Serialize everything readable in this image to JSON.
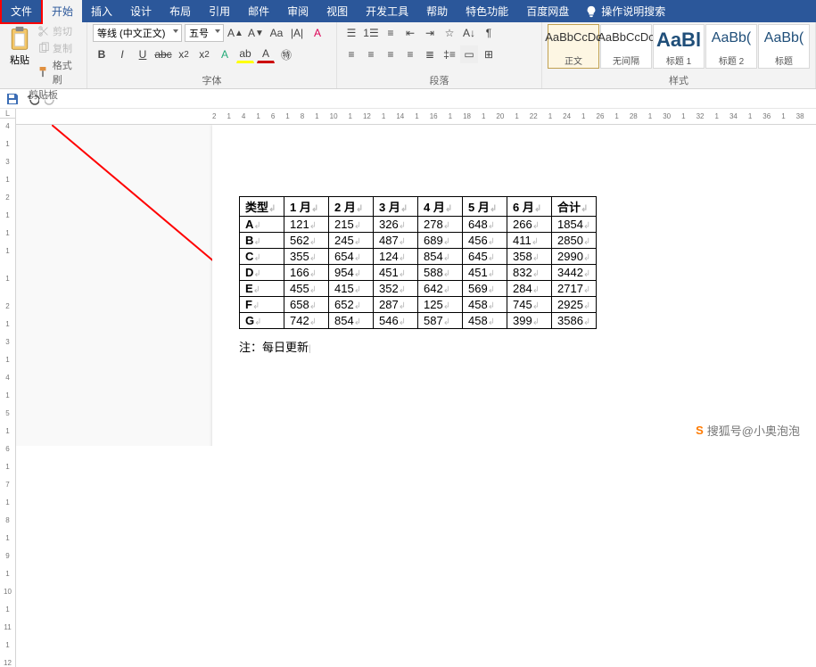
{
  "menu": {
    "file": "文件",
    "home": "开始",
    "insert": "插入",
    "design": "设计",
    "layout": "布局",
    "references": "引用",
    "mailings": "邮件",
    "review": "审阅",
    "view": "视图",
    "developer": "开发工具",
    "help": "帮助",
    "special": "特色功能",
    "baidu": "百度网盘",
    "tellme": "操作说明搜索"
  },
  "ribbon": {
    "clipboard": {
      "paste": "粘贴",
      "cut": "剪切",
      "copy": "复制",
      "format_painter": "格式刷",
      "title": "剪贴板"
    },
    "font": {
      "name": "等线 (中文正文)",
      "size": "五号",
      "title": "字体"
    },
    "paragraph": {
      "title": "段落"
    },
    "styles": {
      "title": "样式",
      "list": [
        {
          "preview": "AaBbCcDc",
          "name": "正文",
          "cls": ""
        },
        {
          "preview": "AaBbCcDc",
          "name": "无间隔",
          "cls": ""
        },
        {
          "preview": "AaBl",
          "name": "标题 1",
          "cls": "big"
        },
        {
          "preview": "AaBb(",
          "name": "标题 2",
          "cls": "h1"
        },
        {
          "preview": "AaBb(",
          "name": "标题",
          "cls": "h1"
        }
      ]
    }
  },
  "ruler": {
    "h": [
      "2",
      "1",
      "4",
      "1",
      "6",
      "1",
      "8",
      "1",
      "10",
      "1",
      "12",
      "1",
      "14",
      "1",
      "16",
      "1",
      "18",
      "1",
      "20",
      "1",
      "22",
      "1",
      "24",
      "1",
      "26",
      "1",
      "28",
      "1",
      "30",
      "1",
      "32",
      "1",
      "34",
      "1",
      "36",
      "1",
      "38"
    ],
    "v": [
      "4",
      "1",
      "3",
      "1",
      "2",
      "1",
      "1",
      "1",
      "",
      "1",
      "",
      "2",
      "1",
      "3",
      "1",
      "4",
      "1",
      "5",
      "1",
      "6",
      "1",
      "7",
      "1",
      "8",
      "1",
      "9",
      "1",
      "10",
      "1",
      "11",
      "1",
      "12"
    ]
  },
  "table": {
    "headers": [
      "类型",
      "1 月",
      "2 月",
      "3 月",
      "4 月",
      "5 月",
      "6 月",
      "合计"
    ],
    "rows": [
      [
        "A",
        "121",
        "215",
        "326",
        "278",
        "648",
        "266",
        "1854"
      ],
      [
        "B",
        "562",
        "245",
        "487",
        "689",
        "456",
        "411",
        "2850"
      ],
      [
        "C",
        "355",
        "654",
        "124",
        "854",
        "645",
        "358",
        "2990"
      ],
      [
        "D",
        "166",
        "954",
        "451",
        "588",
        "451",
        "832",
        "3442"
      ],
      [
        "E",
        "455",
        "415",
        "352",
        "642",
        "569",
        "284",
        "2717"
      ],
      [
        "F",
        "658",
        "652",
        "287",
        "125",
        "458",
        "745",
        "2925"
      ],
      [
        "G",
        "742",
        "854",
        "546",
        "587",
        "458",
        "399",
        "3586"
      ]
    ],
    "note": "注：每日更新"
  },
  "watermark": {
    "text": "搜狐号@小奥泡泡"
  }
}
